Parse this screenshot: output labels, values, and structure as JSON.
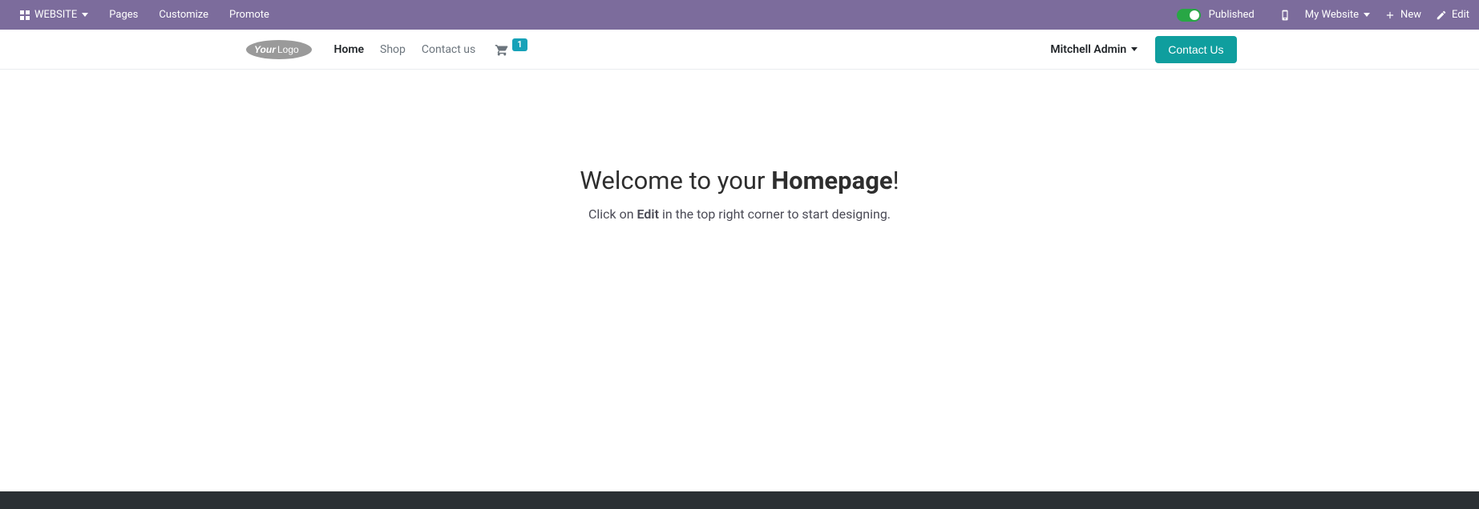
{
  "adminBar": {
    "website": "WEBSITE",
    "pages": "Pages",
    "customize": "Customize",
    "promote": "Promote",
    "published": "Published",
    "myWebsite": "My Website",
    "new": "New",
    "edit": "Edit"
  },
  "siteNav": {
    "logoText1": "Your",
    "logoText2": "Logo",
    "links": {
      "home": "Home",
      "shop": "Shop",
      "contact": "Contact us"
    },
    "cartCount": "1",
    "user": "Mitchell Admin",
    "contactBtn": "Contact Us"
  },
  "hero": {
    "titlePre": "Welcome to your ",
    "titleBold": "Homepage",
    "titlePost": "!",
    "subPre": "Click on ",
    "subBold": "Edit",
    "subPost": " in the top right corner to start designing."
  }
}
